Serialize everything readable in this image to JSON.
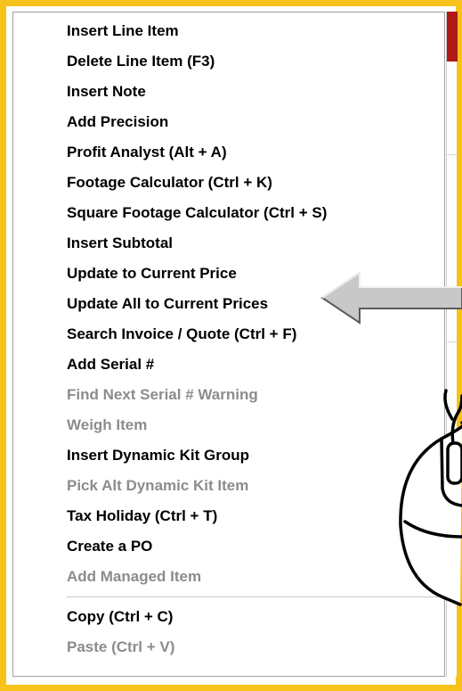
{
  "menu": {
    "items": [
      {
        "label": "Insert Line Item",
        "enabled": true
      },
      {
        "label": "Delete Line Item (F3)",
        "enabled": true
      },
      {
        "label": "Insert Note",
        "enabled": true
      },
      {
        "label": "Add Precision",
        "enabled": true
      },
      {
        "label": "Profit Analyst (Alt + A)",
        "enabled": true
      },
      {
        "label": "Footage Calculator (Ctrl + K)",
        "enabled": true
      },
      {
        "label": "Square Footage Calculator (Ctrl + S)",
        "enabled": true
      },
      {
        "label": "Insert Subtotal",
        "enabled": true
      },
      {
        "label": "Update to Current Price",
        "enabled": true
      },
      {
        "label": "Update All to Current Prices",
        "enabled": true
      },
      {
        "label": "Search Invoice / Quote (Ctrl + F)",
        "enabled": true
      },
      {
        "label": "Add Serial #",
        "enabled": true
      },
      {
        "label": "Find Next Serial # Warning",
        "enabled": false
      },
      {
        "label": "Weigh Item",
        "enabled": false
      },
      {
        "label": "Insert Dynamic Kit Group",
        "enabled": true
      },
      {
        "label": "Pick Alt Dynamic Kit Item",
        "enabled": false
      },
      {
        "label": "Tax Holiday (Ctrl + T)",
        "enabled": true
      },
      {
        "label": "Create a PO",
        "enabled": true
      },
      {
        "label": "Add Managed Item",
        "enabled": false
      },
      {
        "label": "Copy (Ctrl + C)",
        "enabled": true
      },
      {
        "label": "Paste (Ctrl + V)",
        "enabled": false
      }
    ]
  },
  "annotations": {
    "arrow_icon": "left-arrow-icon",
    "mouse_icon": "mouse-icon"
  },
  "colors": {
    "frame_border": "#f7c21a",
    "enabled_text": "#000000",
    "disabled_text": "#8c8c8c",
    "arrow_fill": "#c8c8c8"
  }
}
